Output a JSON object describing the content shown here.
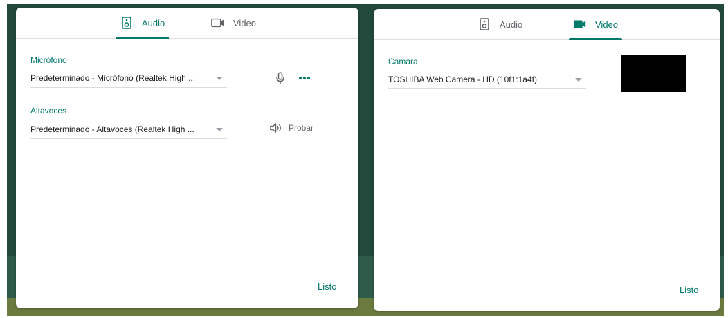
{
  "colors": {
    "accent": "#00796b",
    "text": "#202124",
    "muted": "#5f6368",
    "background": "#23493c",
    "preview": "#000000"
  },
  "audio_dialog": {
    "tabs": [
      {
        "label": "Audio",
        "icon": "speaker-icon",
        "active": true
      },
      {
        "label": "Video",
        "icon": "videocam-icon",
        "active": false
      }
    ],
    "microphone": {
      "label": "Micrófono",
      "value": "Predeterminado - Micrófono (Realtek High ...",
      "icons": [
        "mic-icon",
        "more-icon"
      ]
    },
    "speakers": {
      "label": "Altavoces",
      "value": "Predeterminado - Altavoces (Realtek High ...",
      "test_label": "Probar",
      "test_icon": "volume-icon"
    },
    "done_label": "Listo"
  },
  "video_dialog": {
    "tabs": [
      {
        "label": "Audio",
        "icon": "speaker-icon",
        "active": false
      },
      {
        "label": "Video",
        "icon": "videocam-icon",
        "active": true
      }
    ],
    "camera": {
      "label": "Cámara",
      "value": "TOSHIBA Web Camera - HD (10f1:1a4f)"
    },
    "done_label": "Listo"
  }
}
